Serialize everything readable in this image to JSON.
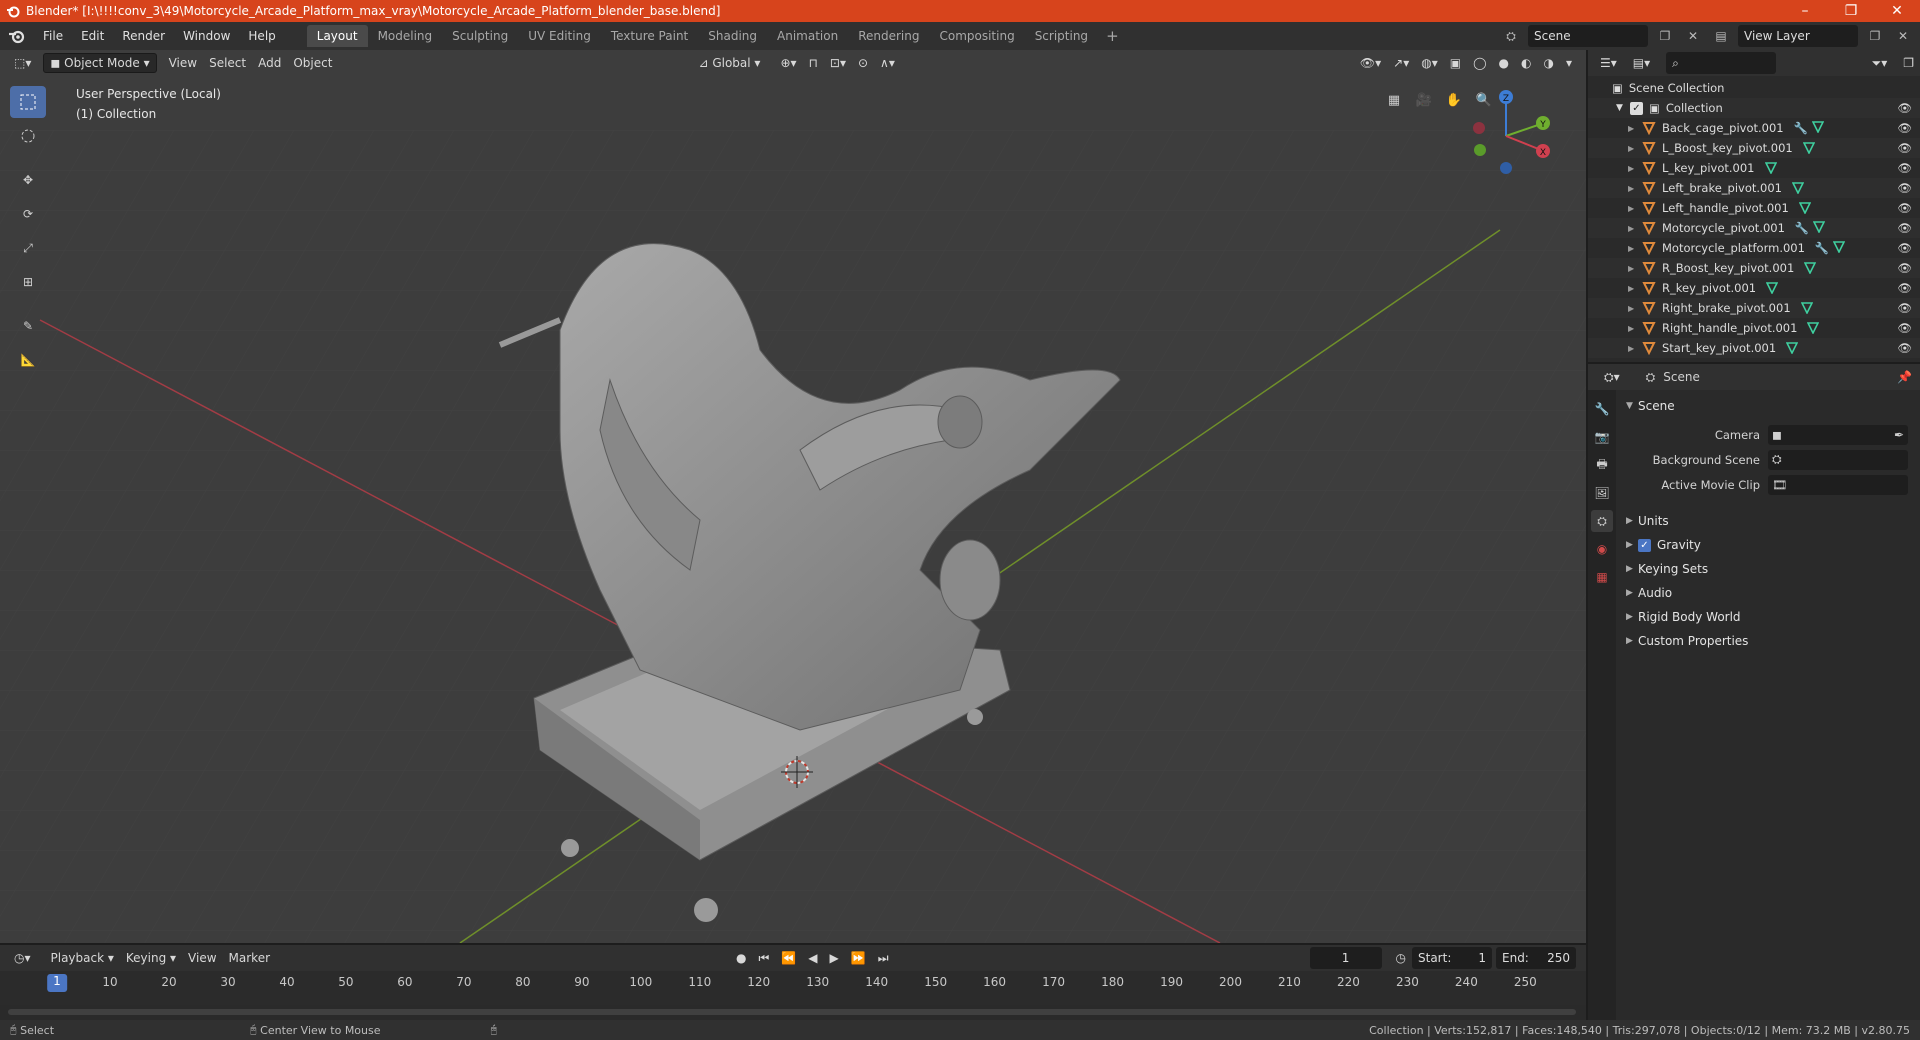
{
  "titlebar": {
    "title": "Blender* [I:\\!!!!conv_3\\49\\Motorcycle_Arcade_Platform_max_vray\\Motorcycle_Arcade_Platform_blender_base.blend]",
    "minimize": "–",
    "maximize": "❐",
    "close": "✕"
  },
  "menubar": {
    "items": [
      "File",
      "Edit",
      "Render",
      "Window",
      "Help"
    ],
    "workspaces": [
      "Layout",
      "Modeling",
      "Sculpting",
      "UV Editing",
      "Texture Paint",
      "Shading",
      "Animation",
      "Rendering",
      "Compositing",
      "Scripting"
    ],
    "add_tab": "+",
    "scene_name": "Scene",
    "view_layer": "View Layer"
  },
  "viewport": {
    "mode": "Object Mode",
    "menus": [
      "View",
      "Select",
      "Add",
      "Object"
    ],
    "transform_orientation": "Global",
    "perspective_label": "User Perspective (Local)",
    "collection_label": "(1) Collection",
    "gizmo": {
      "x": "X",
      "y": "Y",
      "z": "Z"
    }
  },
  "timeline": {
    "menus": [
      "Playback",
      "Keying",
      "View",
      "Marker"
    ],
    "current_frame": "1",
    "start_label": "Start:",
    "start": "1",
    "end_label": "End:",
    "end": "250",
    "ticks": [
      "10",
      "20",
      "30",
      "40",
      "50",
      "60",
      "70",
      "80",
      "90",
      "100",
      "110",
      "120",
      "130",
      "140",
      "150",
      "160",
      "170",
      "180",
      "190",
      "200",
      "210",
      "220",
      "230",
      "240",
      "250"
    ],
    "cursor_frame": "1"
  },
  "statusbar": {
    "left_action": "Select",
    "middle_action": "Center View to Mouse",
    "stats": "Collection | Verts:152,817 | Faces:148,540 | Tris:297,078 | Objects:0/12 | Mem: 73.2 MB | v2.80.75"
  },
  "outliner": {
    "root": "Scene Collection",
    "collection": "Collection",
    "objects": [
      {
        "name": "Back_cage_pivot.001",
        "modifier": true
      },
      {
        "name": "L_Boost_key_pivot.001",
        "modifier": false
      },
      {
        "name": "L_key_pivot.001",
        "modifier": false
      },
      {
        "name": "Left_brake_pivot.001",
        "modifier": false
      },
      {
        "name": "Left_handle_pivot.001",
        "modifier": false
      },
      {
        "name": "Motorcycle_pivot.001",
        "modifier": true
      },
      {
        "name": "Motorcycle_platform.001",
        "modifier": true
      },
      {
        "name": "R_Boost_key_pivot.001",
        "modifier": false
      },
      {
        "name": "R_key_pivot.001",
        "modifier": false
      },
      {
        "name": "Right_brake_pivot.001",
        "modifier": false
      },
      {
        "name": "Right_handle_pivot.001",
        "modifier": false
      },
      {
        "name": "Start_key_pivot.001",
        "modifier": false
      }
    ]
  },
  "properties": {
    "header_title": "Scene",
    "section_title": "Scene",
    "fields": [
      {
        "label": "Camera"
      },
      {
        "label": "Background Scene"
      },
      {
        "label": "Active Movie Clip"
      }
    ],
    "panels": [
      "Units",
      "Gravity",
      "Keying Sets",
      "Audio",
      "Rigid Body World",
      "Custom Properties"
    ]
  },
  "colors": {
    "accent": "#4b76c4",
    "titlebar": "#d7441c",
    "object_icon": "#e08a3c",
    "mesh_icon": "#3fcf9f"
  }
}
